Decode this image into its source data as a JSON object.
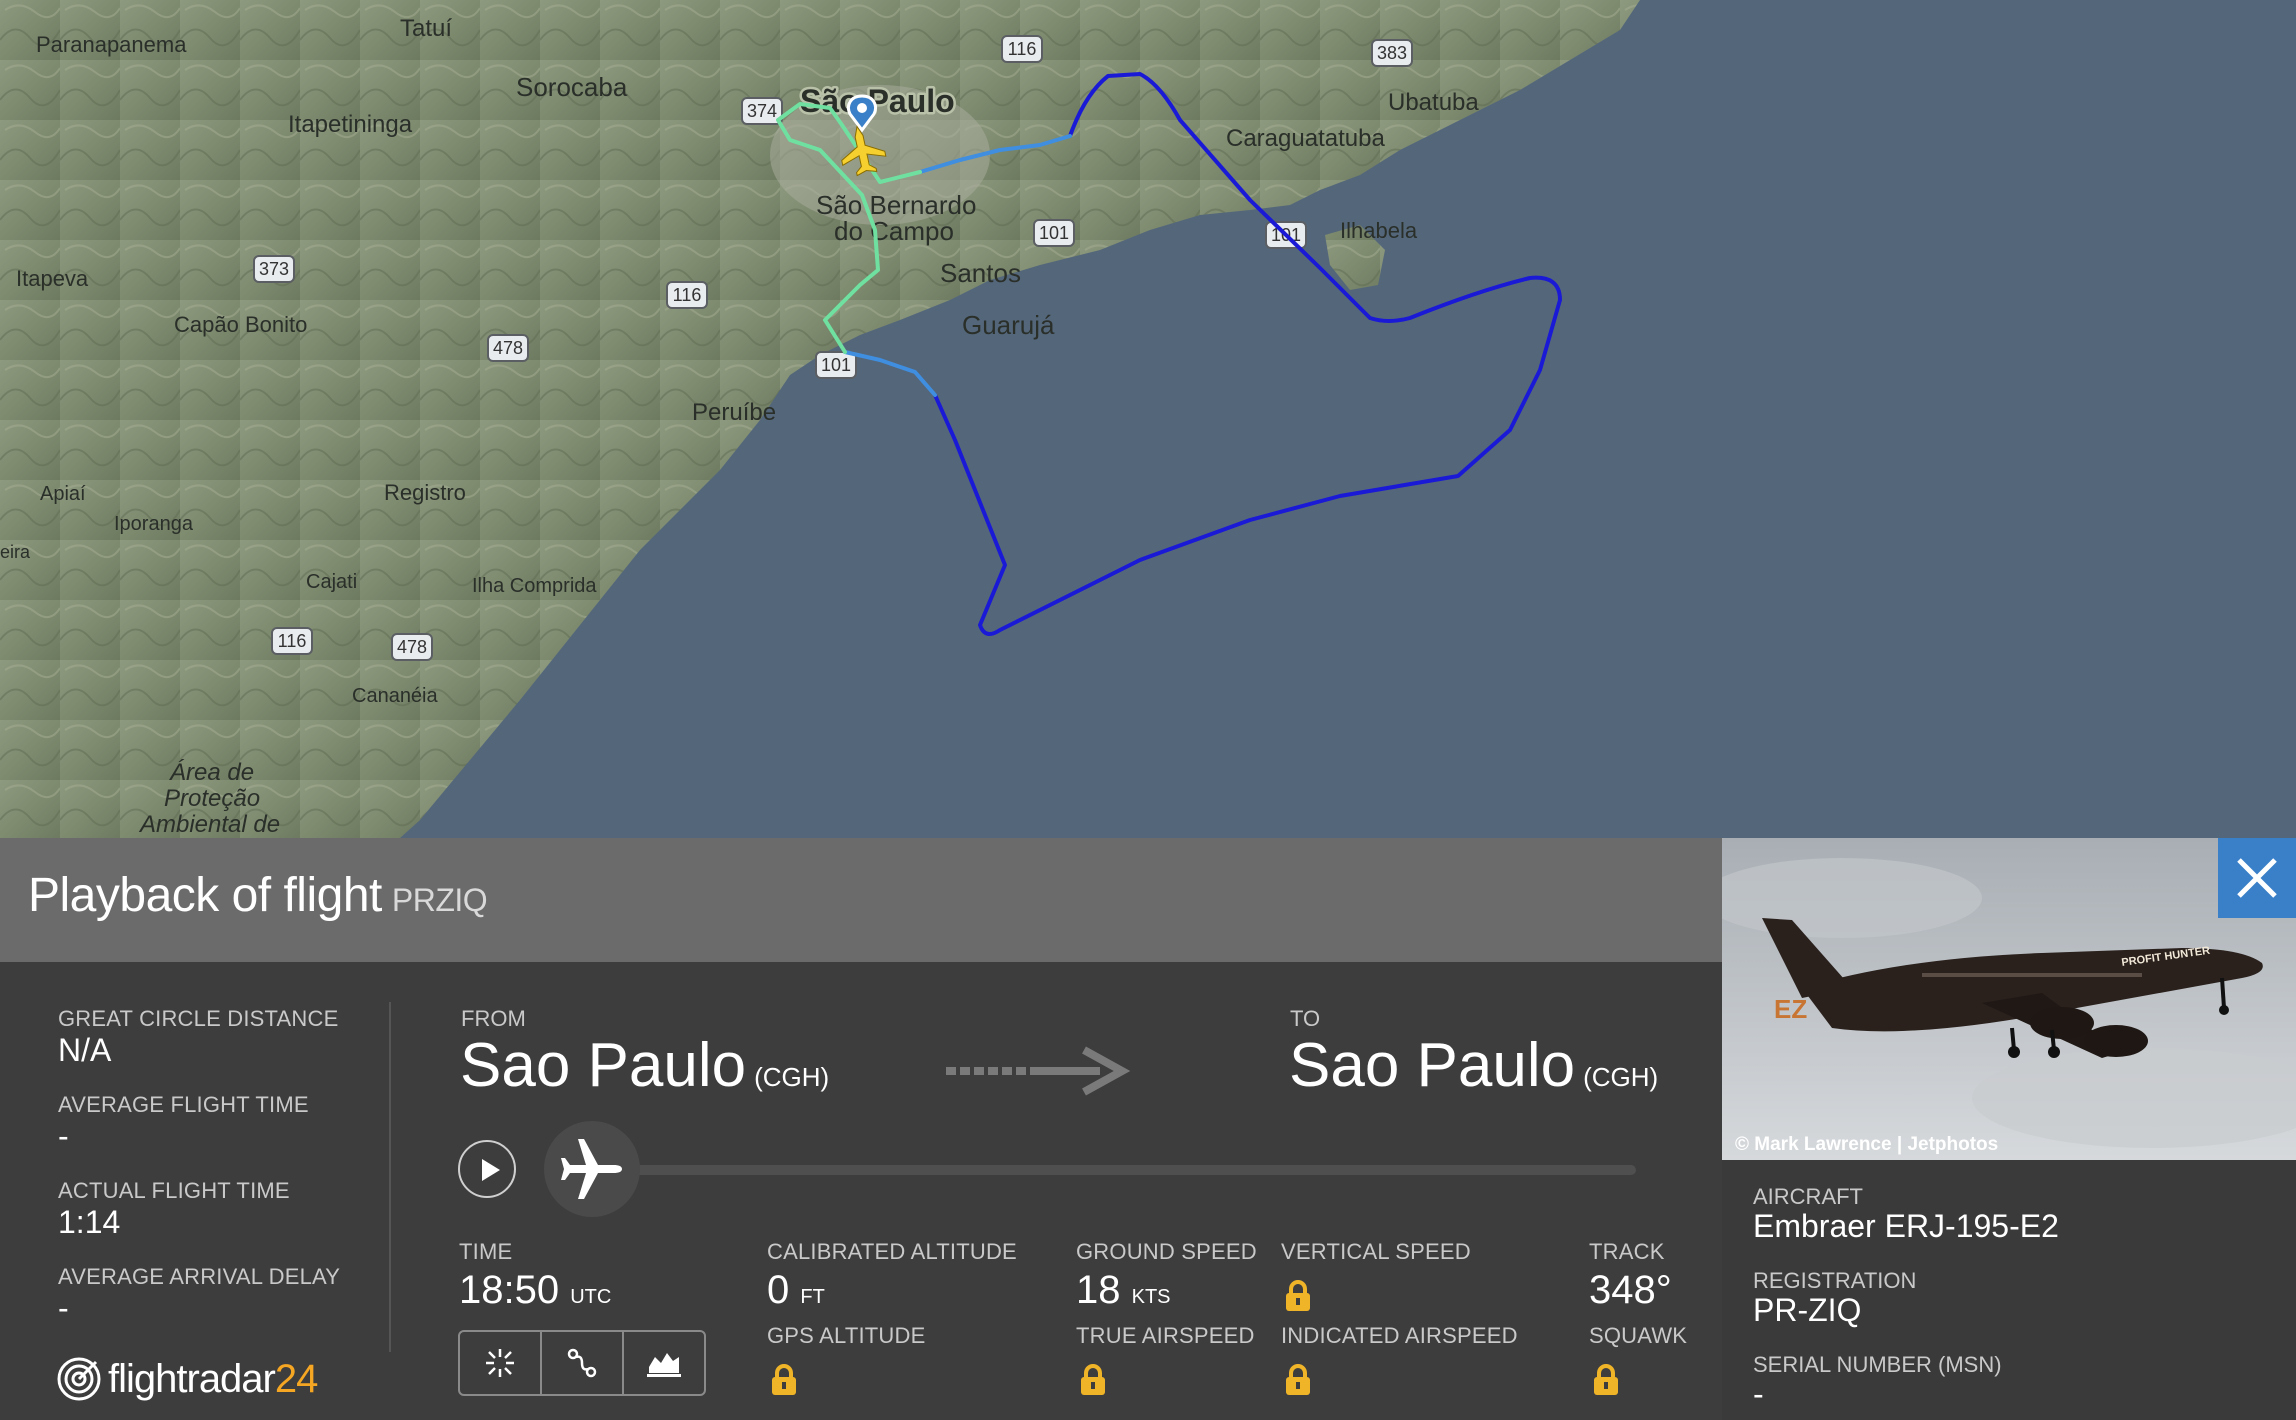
{
  "map": {
    "places": [
      "Paranapanema",
      "Tatuí",
      "Sorocaba",
      "São Paulo",
      "Itapetininga",
      "Ubatuba",
      "Caraguatatuba",
      "São Bernardo",
      "do Campo",
      "Santos",
      "Guarujá",
      "Ilhabela",
      "Itapeva",
      "Capão Bonito",
      "Peruíbe",
      "Registro",
      "Apiaí",
      "Iporanga",
      "eira",
      "Cajati",
      "Ilha Comprida",
      "Cananéia",
      "Área de",
      "Proteção",
      "Ambiental de"
    ],
    "shields": [
      "116",
      "383",
      "374",
      "101",
      "373",
      "116",
      "478",
      "101",
      "101",
      "116",
      "478"
    ]
  },
  "header": {
    "title": "Playback of flight",
    "callsign": "PRZIQ"
  },
  "stats": {
    "great_circle_label": "GREAT CIRCLE DISTANCE",
    "great_circle_value": "N/A",
    "avg_flight_label": "AVERAGE FLIGHT TIME",
    "avg_flight_value": "-",
    "actual_flight_label": "ACTUAL FLIGHT TIME",
    "actual_flight_value": "1:14",
    "avg_delay_label": "AVERAGE ARRIVAL DELAY",
    "avg_delay_value": "-"
  },
  "route": {
    "from_label": "FROM",
    "from_city": "Sao Paulo",
    "from_code": "(CGH)",
    "to_label": "TO",
    "to_city": "Sao Paulo",
    "to_code": "(CGH)"
  },
  "playback": {
    "progress": 0
  },
  "telemetry": {
    "time_label": "TIME",
    "time_value": "18:50",
    "time_unit": "UTC",
    "cal_alt_label": "CALIBRATED ALTITUDE",
    "cal_alt_value": "0",
    "cal_alt_unit": "FT",
    "gps_alt_label": "GPS ALTITUDE",
    "ground_speed_label": "GROUND SPEED",
    "ground_speed_value": "18",
    "ground_speed_unit": "KTS",
    "true_airspeed_label": "TRUE AIRSPEED",
    "vertical_speed_label": "VERTICAL SPEED",
    "indicated_airspeed_label": "INDICATED AIRSPEED",
    "track_label": "TRACK",
    "track_value": "348°",
    "squawk_label": "SQUAWK"
  },
  "logo": {
    "word": "flightradar",
    "num": "24"
  },
  "aircraft_panel": {
    "photo_credit": "© Mark Lawrence | Jetphotos",
    "livery_text": "PROFIT HUNTER",
    "tail_text": "EZ",
    "aircraft_label": "AIRCRAFT",
    "aircraft_value": "Embraer ERJ-195-E2",
    "registration_label": "REGISTRATION",
    "registration_value": "PR-ZIQ",
    "serial_label": "SERIAL NUMBER (MSN)",
    "serial_value": "-"
  },
  "colors": {
    "track_far": "#1a1ad6",
    "track_mid": "#3f8ee0",
    "track_near": "#6fe0a0",
    "accent": "#3a80c8",
    "lock": "#f0b429",
    "logo_accent": "#f5a623"
  }
}
